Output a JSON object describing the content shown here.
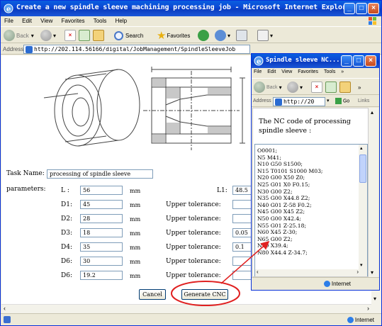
{
  "main_window": {
    "title": "Create a new spindle sleeve machining processing job - Microsoft Internet Explorer",
    "menu": [
      "File",
      "Edit",
      "View",
      "Favorites",
      "Tools",
      "Help"
    ],
    "toolbar": {
      "back": "Back",
      "search": "Search",
      "favorites": "Favorites"
    },
    "address_label": "Address",
    "address": "http://202.114.56166/digital/JobManagement/SpindleSleeveJob",
    "status_zone": "Internet"
  },
  "form": {
    "task_name_label": "Task Name:",
    "task_name_value": "processing of spindle sleeve",
    "parameters_label": "parameters:",
    "unit": "mm",
    "upper_tolerance_label": "Upper tolerance:",
    "rows": [
      {
        "label": "L :",
        "value": "56"
      },
      {
        "label": "D1:",
        "value": "45"
      },
      {
        "label": "D2:",
        "value": "28"
      },
      {
        "label": "D3:",
        "value": "18"
      },
      {
        "label": "D4:",
        "value": "35"
      },
      {
        "label": "D6:",
        "value": "30"
      },
      {
        "label": "D6:",
        "value": "19.2"
      }
    ],
    "l1_label": "L1:",
    "l1_value": "48.5",
    "tolerances": [
      "",
      "",
      "0.05",
      "0.1",
      "",
      ""
    ],
    "cancel_label": "Cancel",
    "generate_label": "Generate CNC"
  },
  "popup": {
    "title": "Spindle sleeve NC...",
    "menu": [
      "File",
      "Edit",
      "View",
      "Favorites",
      "Tools"
    ],
    "toolbar": {
      "back": "Back"
    },
    "address_label": "Address",
    "address": "http://20",
    "go_label": "Go",
    "links_label": "Links",
    "heading": "The NC code of processing spindle sleeve :",
    "nc_code": [
      "O0001;",
      "N5 M41;",
      "N10 G50 S1500;",
      "N15 T0101 S1000 M03;",
      "N20 G00 X50 Z0;",
      "N25 G01 X0 F0.15;",
      "N30 G00 Z2;",
      "N35 G00 X44.8 Z2;",
      "N40 G01 Z-58 F0.2;",
      "N45 G00 X45 Z2;",
      "N50 G00 X42.4;",
      "N55 G01 Z-25.18;",
      "N60 X45 Z-30;",
      "N65 G00 Z2;",
      "N70 X39.4;",
      "N80 X44.4 Z-34.7;"
    ],
    "status_zone": "Internet"
  },
  "colors": {
    "titlebar": "#0b47d4",
    "annotation": "#e02020",
    "window_bg": "#ece9d8"
  }
}
